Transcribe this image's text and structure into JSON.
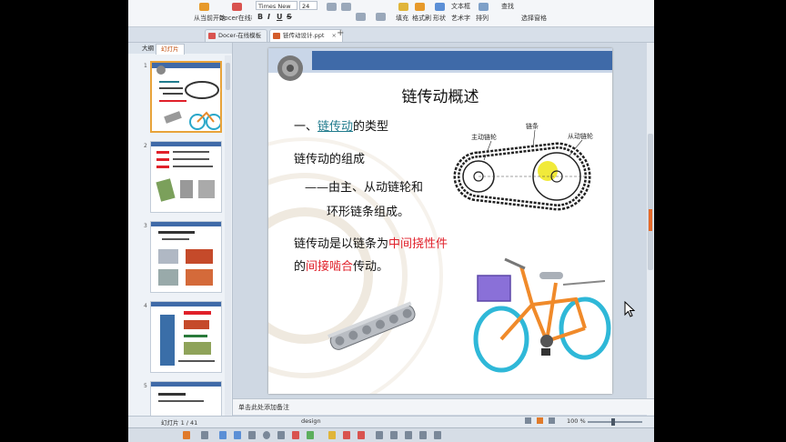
{
  "ribbon": {
    "buttons": [
      "从当前开始",
      "Docer在线模板",
      "文本框",
      "艺术字",
      "选择窗格",
      "填充",
      "格式刷",
      "形状",
      "排列",
      "查找"
    ],
    "font_name": "Times New Ro",
    "font_size": "24",
    "format_buttons": [
      "B",
      "I",
      "U",
      "S"
    ]
  },
  "tabs": [
    {
      "label": "Docer-在线模板",
      "active": false
    },
    {
      "label": "链传动设计.ppt",
      "active": true
    }
  ],
  "panel": {
    "tabs": [
      "大纲",
      "幻灯片"
    ],
    "thumb_numbers": [
      "1",
      "2",
      "3",
      "4",
      "5"
    ]
  },
  "slide": {
    "title": "链传动概述",
    "heading_prefix": "一、",
    "heading_link": "链传动",
    "heading_suffix": "的类型",
    "composition": "链传动的组成",
    "desc_line1": "——由主、从动链轮和",
    "desc_line2": "环形链条组成。",
    "def_part1": "链传动是以链条为",
    "def_red1": "中间挠性件",
    "def_part2": "的",
    "def_red2": "间接啮合",
    "def_part3": "传动。",
    "diagram_labels": {
      "driver": "主动链轮",
      "chain": "链条",
      "driven": "从动链轮"
    }
  },
  "notes_placeholder": "单击此处添加备注",
  "status": {
    "slide_counter": "幻灯片 1 / 41",
    "theme": "design",
    "zoom": "100 %"
  },
  "colors": {
    "title_bar": "#3f6aa8",
    "link": "#1f7a8c",
    "emphasis": "#e0202a",
    "selection": "#e8a33a"
  }
}
